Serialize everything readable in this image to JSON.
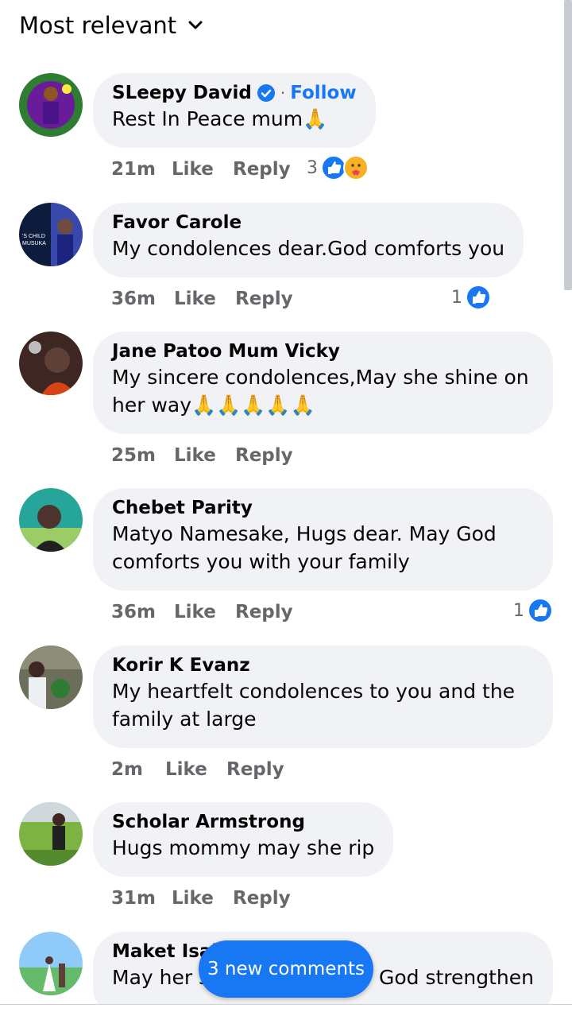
{
  "header": {
    "sort_label": "Most relevant"
  },
  "comments": [
    {
      "name": "SLeepy David",
      "verified": true,
      "follow_label": "Follow",
      "separator": "·",
      "text": "Rest In Peace mum🙏",
      "time": "21m",
      "like_label": "Like",
      "reply_label": "Reply",
      "reaction_count": "3"
    },
    {
      "name": "Favor Carole",
      "text": "My condolences dear.God comforts you",
      "time": "36m",
      "like_label": "Like",
      "reply_label": "Reply",
      "reaction_count": "1",
      "avatar_text_top": "'S CHILD",
      "avatar_text_bottom": "MUSUKA"
    },
    {
      "name": "Jane Patoo Mum Vicky",
      "text": "My sincere condolences,May she shine on her way🙏🙏🙏🙏🙏",
      "time": "25m",
      "like_label": "Like",
      "reply_label": "Reply"
    },
    {
      "name": "Chebet Parity",
      "text": "Matyo Namesake, Hugs dear. May God comforts you with your family",
      "time": "36m",
      "like_label": "Like",
      "reply_label": "Reply",
      "reaction_count": "1"
    },
    {
      "name": "Korir K Evanz",
      "text": "My heartfelt condolences to you and the family at large",
      "time": "2m",
      "like_label": "Like",
      "reply_label": "Reply"
    },
    {
      "name": "Scholar Armstrong",
      "text": "Hugs mommy may she rip",
      "time": "31m",
      "like_label": "Like",
      "reply_label": "Reply"
    },
    {
      "name": "Maket Isaiah",
      "text_left": "May her s",
      "text_right": "God strengthen"
    }
  ],
  "new_comments_label": "3 new comments",
  "colors": {
    "accent": "#1877f2",
    "bubble": "#f0f2f5",
    "meta": "#65676b",
    "text": "#050505"
  }
}
